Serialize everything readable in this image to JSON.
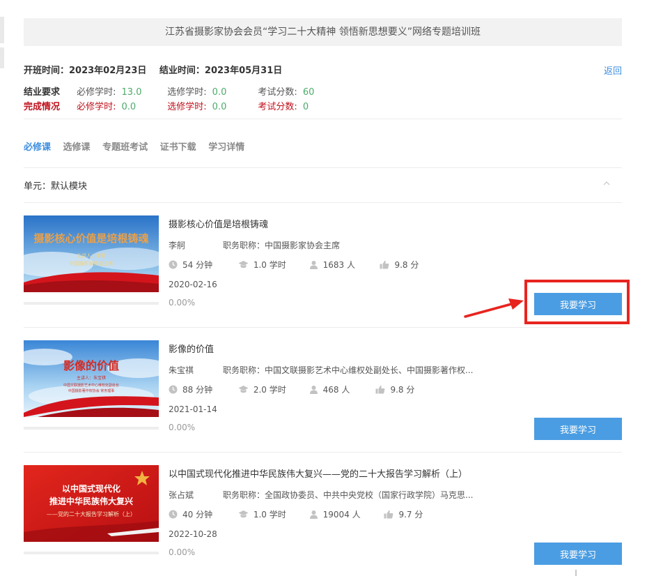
{
  "banner": {
    "title": "江苏省摄影家协会会员“学习二十大精神 领悟新思想要义”网络专题培训班"
  },
  "schedule": {
    "start": "开班时间：2023年02月23日",
    "end": "结业时间：2023年05月31日",
    "back_label": "返回"
  },
  "requirements": {
    "label": "结业要求",
    "required_label": "必修学时:",
    "required_value": "13.0",
    "elective_label": "选修学时:",
    "elective_value": "0.0",
    "exam_label": "考试分数:",
    "exam_value": "60"
  },
  "completion": {
    "label": "完成情况",
    "required_label": "必修学时:",
    "required_value": "0.0",
    "elective_label": "选修学时:",
    "elective_value": "0.0",
    "exam_label": "考试分数:",
    "exam_value": "0"
  },
  "tabs": [
    {
      "label": "必修课",
      "active": true
    },
    {
      "label": "选修课",
      "active": false
    },
    {
      "label": "专题班考试",
      "active": false
    },
    {
      "label": "证书下载",
      "active": false
    },
    {
      "label": "学习详情",
      "active": false
    }
  ],
  "unit": {
    "label": "单元：默认模块"
  },
  "courses": [
    {
      "title": "摄影核心价值是培根铸魂",
      "teacher": "李舸",
      "position": "职务职称：中国摄影家协会主席",
      "duration": "54 分钟",
      "credits": "1.0 学时",
      "learners": "1683 人",
      "rating": "9.8 分",
      "date": "2020-02-16",
      "progress": "0.00%",
      "progress_value": 0,
      "button": "我要学习",
      "thumb_title": "摄影核心价值是培根铸魂",
      "thumb_lines": [
        "主讲人：李舸",
        "中国摄影家协会主席"
      ]
    },
    {
      "title": "影像的价值",
      "teacher": "朱宝祺",
      "position": "职务职称：中国文联摄影艺术中心维权处副处长、中国摄影著作权...",
      "duration": "88 分钟",
      "credits": "2.0 学时",
      "learners": "468 人",
      "rating": "9.8 分",
      "date": "2021-01-14",
      "progress": "0.00%",
      "progress_value": 0,
      "button": "我要学习",
      "thumb_title": "影像的价值",
      "thumb_lines": [
        "主讲人：朱宝祺",
        "中国文联摄影艺术中心维权处副处长",
        "中国摄影著作权协会 常务理事"
      ]
    },
    {
      "title": "以中国式现代化推进中华民族伟大复兴——党的二十大报告学习解析（上）",
      "teacher": "张占斌",
      "position": "职务职称：全国政协委员、中共中央党校（国家行政学院）马克思...",
      "duration": "40 分钟",
      "credits": "1.0 学时",
      "learners": "19004 人",
      "rating": "9.7 分",
      "date": "2022-10-28",
      "progress": "0.00%",
      "progress_value": 0,
      "button": "我要学习",
      "thumb_lines": [
        "以中国式现代化",
        "推进中华民族伟大复兴",
        "——党的二十大报告学习解析（上）"
      ]
    }
  ],
  "colors": {
    "accent": "#3d8ee0",
    "button": "#4a9de2",
    "required_red": "#c0121d",
    "value_green": "#4caa6a",
    "highlight": "#e8241f"
  },
  "icons": [
    "clock-icon",
    "graduation-cap-icon",
    "user-icon",
    "thumbs-up-icon",
    "chevron-up-icon"
  ]
}
